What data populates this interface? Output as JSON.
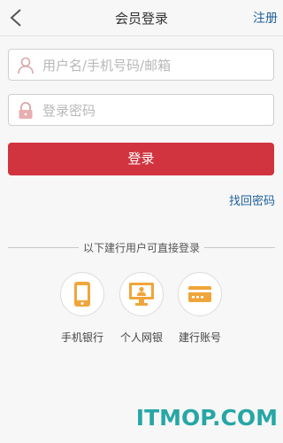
{
  "header": {
    "title": "会员登录",
    "register_label": "注册",
    "back_icon": "chevron-left-icon"
  },
  "form": {
    "username": {
      "value": "",
      "placeholder": "用户名/手机号码/邮箱",
      "icon": "user-icon"
    },
    "password": {
      "value": "",
      "placeholder": "登录密码",
      "icon": "lock-icon"
    },
    "login_label": "登录",
    "forgot_label": "找回密码"
  },
  "quick_login": {
    "divider_text": "以下建行用户可直接登录",
    "items": [
      {
        "label": "手机银行",
        "icon": "mobile-phone-icon"
      },
      {
        "label": "个人网银",
        "icon": "computer-user-icon"
      },
      {
        "label": "建行账号",
        "icon": "bank-card-icon"
      }
    ]
  },
  "watermark": "ITMOP.COM",
  "colors": {
    "accent_red": "#d1343f",
    "link_blue": "#1e5f9a",
    "icon_orange": "#f0a53a",
    "watermark_teal": "#28a6a6"
  }
}
